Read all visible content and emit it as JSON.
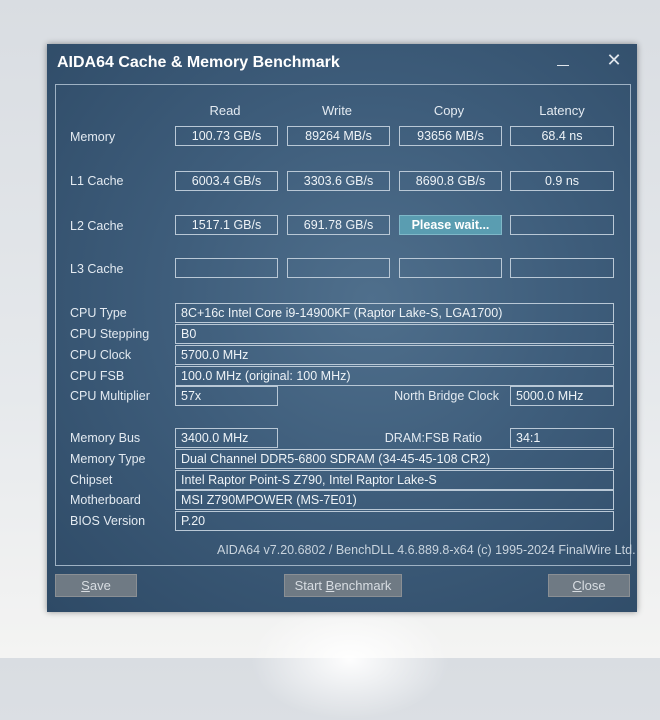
{
  "window": {
    "title": "AIDA64 Cache & Memory Benchmark",
    "close_glyph": "✕"
  },
  "columns": {
    "read": "Read",
    "write": "Write",
    "copy": "Copy",
    "latency": "Latency"
  },
  "rows": {
    "memory": {
      "label": "Memory",
      "read": "100.73 GB/s",
      "write": "89264 MB/s",
      "copy": "93656 MB/s",
      "latency": "68.4 ns"
    },
    "l1": {
      "label": "L1 Cache",
      "read": "6003.4 GB/s",
      "write": "3303.6 GB/s",
      "copy": "8690.8 GB/s",
      "latency": "0.9 ns"
    },
    "l2": {
      "label": "L2 Cache",
      "read": "1517.1 GB/s",
      "write": "691.78 GB/s",
      "copy": "Please wait...",
      "latency": ""
    },
    "l3": {
      "label": "L3 Cache",
      "read": "",
      "write": "",
      "copy": "",
      "latency": ""
    }
  },
  "info": {
    "cpu_type": {
      "label": "CPU Type",
      "value": "8C+16c Intel Core i9-14900KF  (Raptor Lake-S, LGA1700)"
    },
    "cpu_stepping": {
      "label": "CPU Stepping",
      "value": "B0"
    },
    "cpu_clock": {
      "label": "CPU Clock",
      "value": "5700.0 MHz"
    },
    "cpu_fsb": {
      "label": "CPU FSB",
      "value": "100.0 MHz  (original: 100 MHz)"
    },
    "cpu_multiplier": {
      "label": "CPU Multiplier",
      "value": "57x"
    },
    "nb_clock": {
      "label": "North Bridge Clock",
      "value": "5000.0 MHz"
    },
    "memory_bus": {
      "label": "Memory Bus",
      "value": "3400.0 MHz"
    },
    "dram_fsb": {
      "label": "DRAM:FSB Ratio",
      "value": "34:1"
    },
    "memory_type": {
      "label": "Memory Type",
      "value": "Dual Channel DDR5-6800 SDRAM  (34-45-45-108 CR2)"
    },
    "chipset": {
      "label": "Chipset",
      "value": "Intel Raptor Point-S Z790, Intel Raptor Lake-S"
    },
    "motherboard": {
      "label": "Motherboard",
      "value": "MSI Z790MPOWER (MS-7E01)"
    },
    "bios": {
      "label": "BIOS Version",
      "value": "P.20"
    }
  },
  "footer": "AIDA64 v7.20.6802 / BenchDLL 4.6.889.8-x64  (c) 1995-2024 FinalWire Ltd.",
  "buttons": {
    "save_first": "S",
    "save_rest": "ave",
    "bench_pre": "Start ",
    "bench_ul": "B",
    "bench_rest": "enchmark",
    "close_first": "C",
    "close_rest": "lose"
  }
}
